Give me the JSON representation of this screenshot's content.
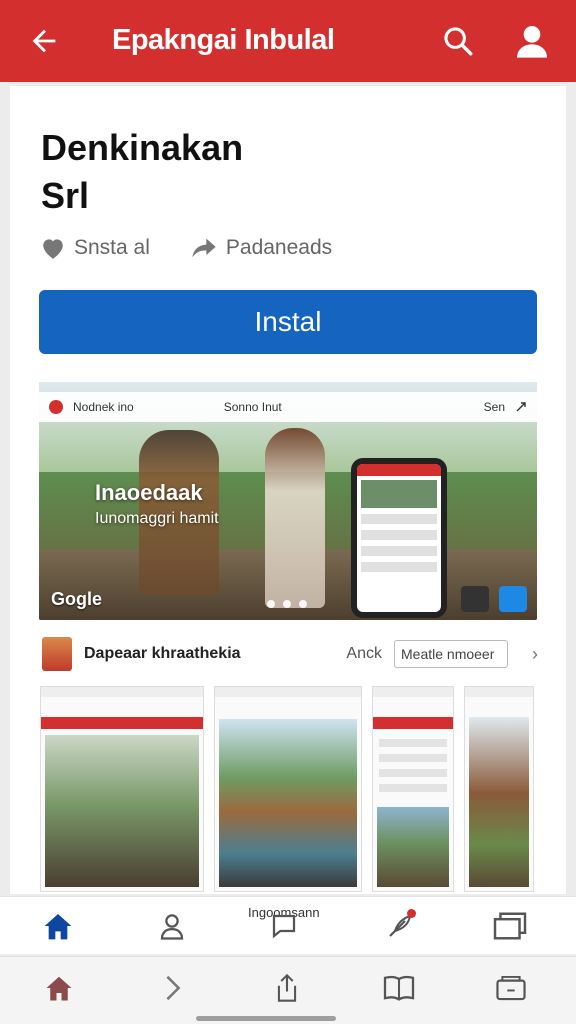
{
  "header": {
    "title": "Epakngai Inbulal",
    "back_icon": "arrow-left-icon",
    "search_icon": "search-icon",
    "account_icon": "account-icon"
  },
  "app": {
    "title_line1": "Denkinakan",
    "title_line2": "Srl",
    "wishlist_label": "Snsta al",
    "share_label": "Padaneads",
    "install_label": "Instal"
  },
  "hero": {
    "bar_left": "Nodnek ino",
    "bar_mid": "Sonno Inut",
    "bar_right": "Sen",
    "caption_line1": "Inaoedaak",
    "caption_line2": "Iunomaggri hamit",
    "brand": "Gogle"
  },
  "developer": {
    "name": "Dapeaar khraathekia",
    "anck": "Anck",
    "field_value": "Meatle nmoeer"
  },
  "tabbar": {
    "label": "Ingoomsann"
  },
  "colors": {
    "brand_red": "#d32f2f",
    "install_blue": "#1565c0"
  }
}
